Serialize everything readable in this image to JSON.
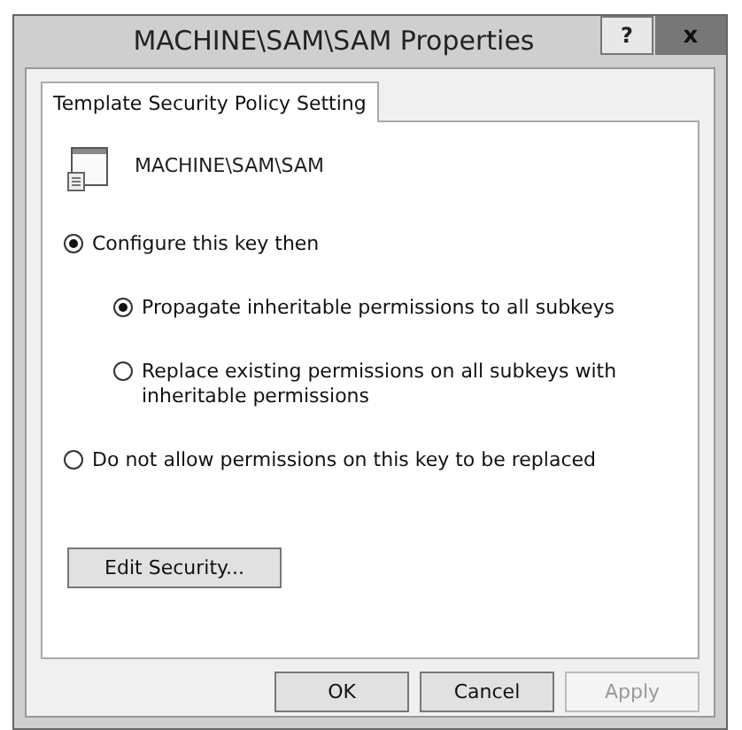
{
  "window": {
    "title": "MACHINE\\SAM\\SAM Properties",
    "help_button": "?",
    "close_button": "x"
  },
  "tabs": [
    {
      "label": "Template Security Policy Setting",
      "selected": true
    }
  ],
  "key_path": "MACHINE\\SAM\\SAM",
  "options": [
    {
      "label": "Configure this key then",
      "selected": true,
      "children": [
        {
          "label": "Propagate inheritable permissions to all subkeys",
          "selected": true
        },
        {
          "label": "Replace existing permissions on all subkeys with inheritable permissions",
          "selected": false
        }
      ]
    },
    {
      "label": "Do not allow permissions on this key to be replaced",
      "selected": false
    }
  ],
  "edit_button": "Edit Security...",
  "buttons": [
    {
      "label": "OK",
      "disabled": false
    },
    {
      "label": "Cancel",
      "disabled": false
    },
    {
      "label": "Apply",
      "disabled": true
    }
  ]
}
